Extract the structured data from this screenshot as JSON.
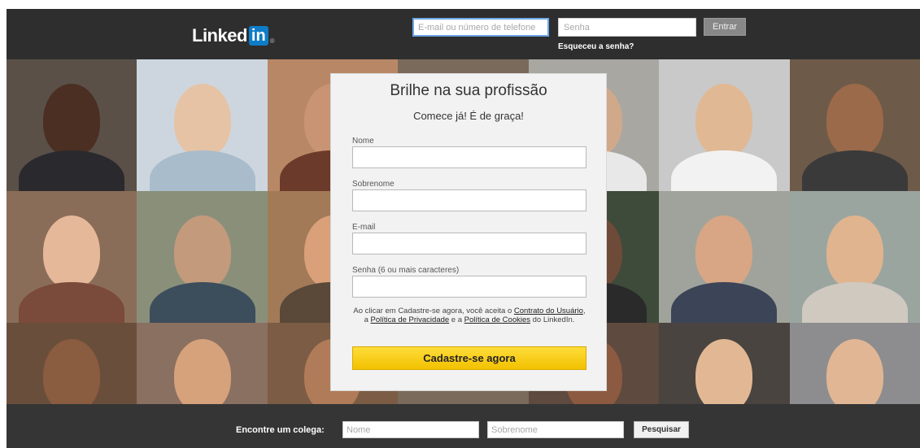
{
  "header": {
    "logo_text": "Linked",
    "logo_badge": "in",
    "email_placeholder": "E-mail ou número de telefone",
    "password_placeholder": "Senha",
    "login_button": "Entrar",
    "forgot_link": "Esqueceu a senha?"
  },
  "signup": {
    "title": "Brilhe na sua profissão",
    "subtitle": "Comece já! É de graça!",
    "fields": {
      "first_name": "Nome",
      "last_name": "Sobrenome",
      "email": "E-mail",
      "password": "Senha (6 ou mais caracteres)"
    },
    "terms": {
      "part1": "Ao clicar em Cadastre-se agora, você aceita o ",
      "link1": "Contrato do Usuário",
      "part2": ", a ",
      "link2": "Política de Privacidade",
      "part3": " e a ",
      "link3": "Política de Cookies",
      "part4": " do LinkedIn."
    },
    "button": "Cadastre-se agora"
  },
  "find_colleague": {
    "label": "Encontre um colega:",
    "first_placeholder": "Nome",
    "last_placeholder": "Sobrenome",
    "button": "Pesquisar"
  },
  "colors": {
    "header_bg": "#2e2e2e",
    "brand_blue": "#0e7cc7",
    "cta_yellow": "#f5c600",
    "footer_bg": "#353535"
  }
}
